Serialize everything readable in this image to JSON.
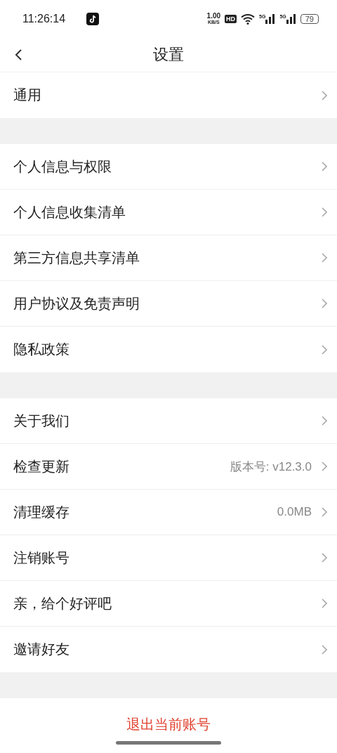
{
  "status_bar": {
    "time": "11:26:14",
    "network_speed": "1.00",
    "speed_unit": "KB/S",
    "hd": "HD",
    "signals": [
      "5G",
      "5G"
    ],
    "battery": "79"
  },
  "header": {
    "title": "设置"
  },
  "groups": [
    {
      "items": [
        {
          "label": "通用"
        }
      ]
    },
    {
      "items": [
        {
          "label": "个人信息与权限"
        },
        {
          "label": "个人信息收集清单"
        },
        {
          "label": "第三方信息共享清单"
        },
        {
          "label": "用户协议及免责声明"
        },
        {
          "label": "隐私政策"
        }
      ]
    },
    {
      "items": [
        {
          "label": "关于我们"
        },
        {
          "label": "检查更新",
          "value": "版本号: v12.3.0"
        },
        {
          "label": "清理缓存",
          "value": "0.0MB"
        },
        {
          "label": "注销账号"
        },
        {
          "label": "亲，给个好评吧"
        },
        {
          "label": "邀请好友"
        }
      ]
    }
  ],
  "logout_button": {
    "label": "退出当前账号"
  }
}
